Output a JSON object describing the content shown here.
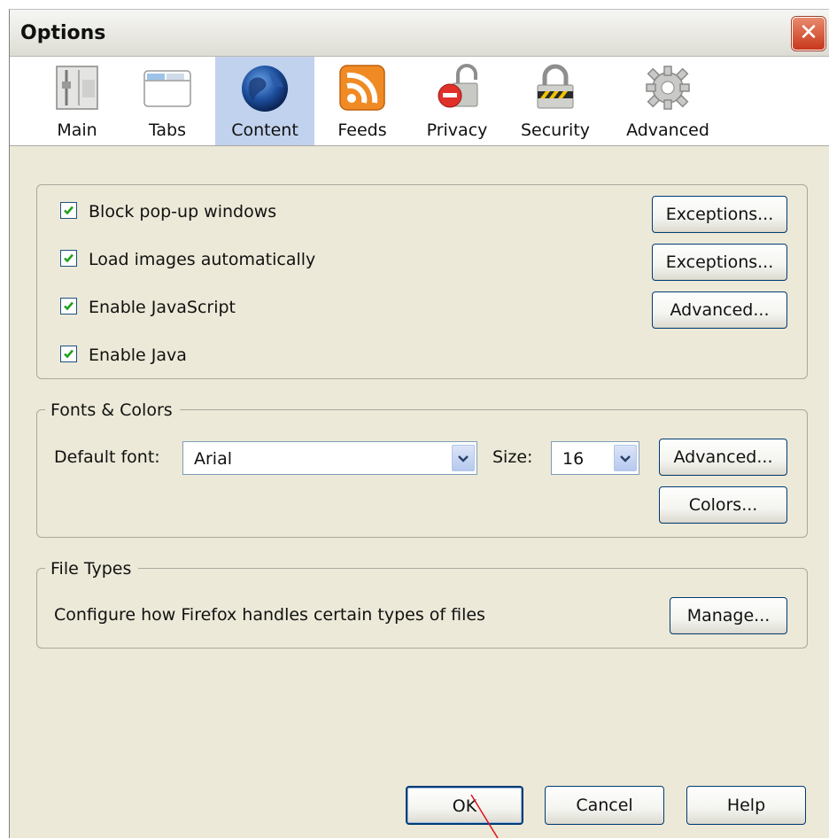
{
  "window": {
    "title": "Options"
  },
  "tabs": [
    {
      "key": "main",
      "label": "Main",
      "icon": "main-settings-icon"
    },
    {
      "key": "tabs",
      "label": "Tabs",
      "icon": "tabs-icon"
    },
    {
      "key": "content",
      "label": "Content",
      "icon": "globe-icon",
      "selected": true
    },
    {
      "key": "feeds",
      "label": "Feeds",
      "icon": "rss-feed-icon"
    },
    {
      "key": "privacy",
      "label": "Privacy",
      "icon": "privacy-lock-icon"
    },
    {
      "key": "security",
      "label": "Security",
      "icon": "security-padlock-icon"
    },
    {
      "key": "advanced",
      "label": "Advanced",
      "icon": "gear-icon"
    }
  ],
  "content": {
    "checkboxes": [
      {
        "label": "Block pop-up windows",
        "checked": true,
        "button": "Exceptions..."
      },
      {
        "label": "Load images automatically",
        "checked": true,
        "button": "Exceptions..."
      },
      {
        "label": "Enable JavaScript",
        "checked": true,
        "button": "Advanced..."
      },
      {
        "label": "Enable Java",
        "checked": true
      }
    ],
    "fonts": {
      "legend": "Fonts & Colors",
      "default_font_label": "Default font:",
      "default_font_value": "Arial",
      "size_label": "Size:",
      "size_value": "16",
      "advanced_button": "Advanced...",
      "colors_button": "Colors..."
    },
    "file_types": {
      "legend": "File Types",
      "description": "Configure how Firefox handles certain types of files",
      "manage_button": "Manage..."
    }
  },
  "footer": {
    "ok": "OK",
    "cancel": "Cancel",
    "help": "Help"
  },
  "colors": {
    "selected_tab": "#c1d2ee",
    "dialog_bg": "#ece9d8",
    "button_border": "#003c74",
    "annotation_line": "#e0101e"
  }
}
